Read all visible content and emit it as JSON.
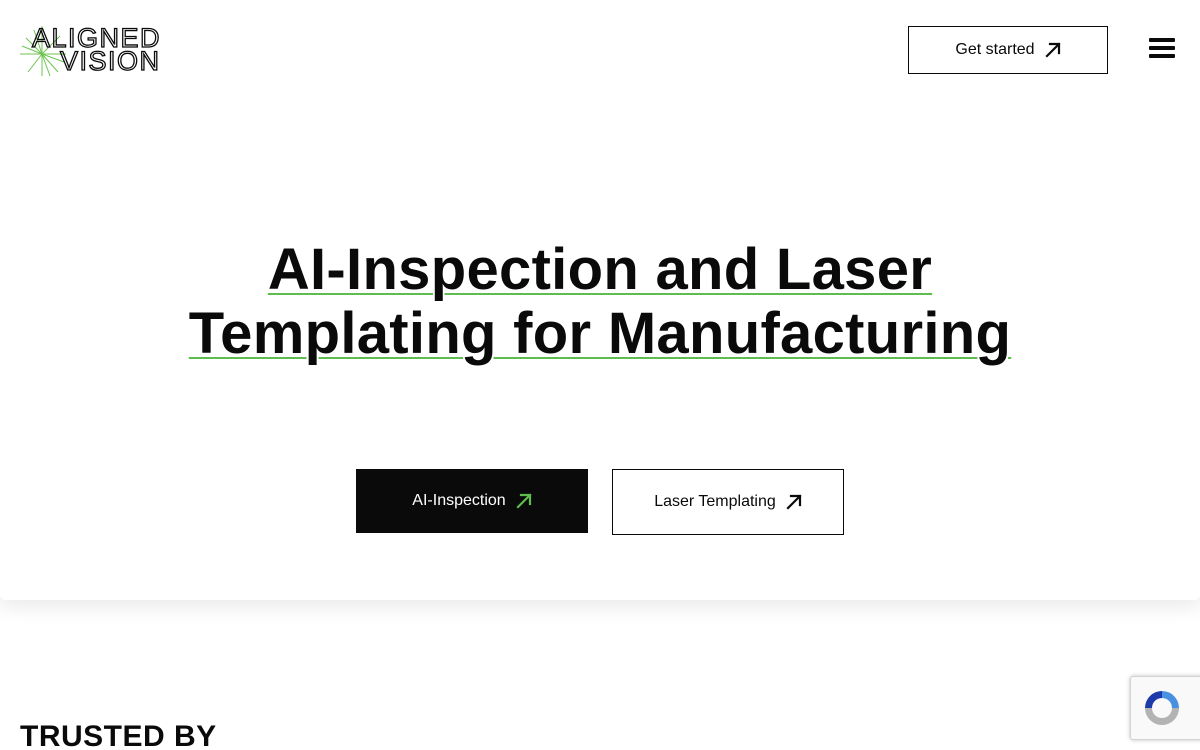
{
  "header": {
    "logo_text_top": "ALIGNED",
    "logo_text_bottom": "VISION",
    "get_started_label": "Get started",
    "menu_icon": "hamburger-menu-icon"
  },
  "hero": {
    "headline_line1": "AI-Inspection and Laser",
    "headline_line2": "Templating for Manufacturing",
    "buttons": [
      {
        "label": "AI-Inspection",
        "icon": "arrow-up-right-icon",
        "style": "dark"
      },
      {
        "label": "Laser Templating",
        "icon": "arrow-up-right-icon",
        "style": "outline"
      }
    ]
  },
  "sections": {
    "trusted_by_title": "TRUSTED BY"
  },
  "colors": {
    "accent_green": "#5fbd4f",
    "text": "#0a0a0a",
    "background": "#ffffff"
  }
}
